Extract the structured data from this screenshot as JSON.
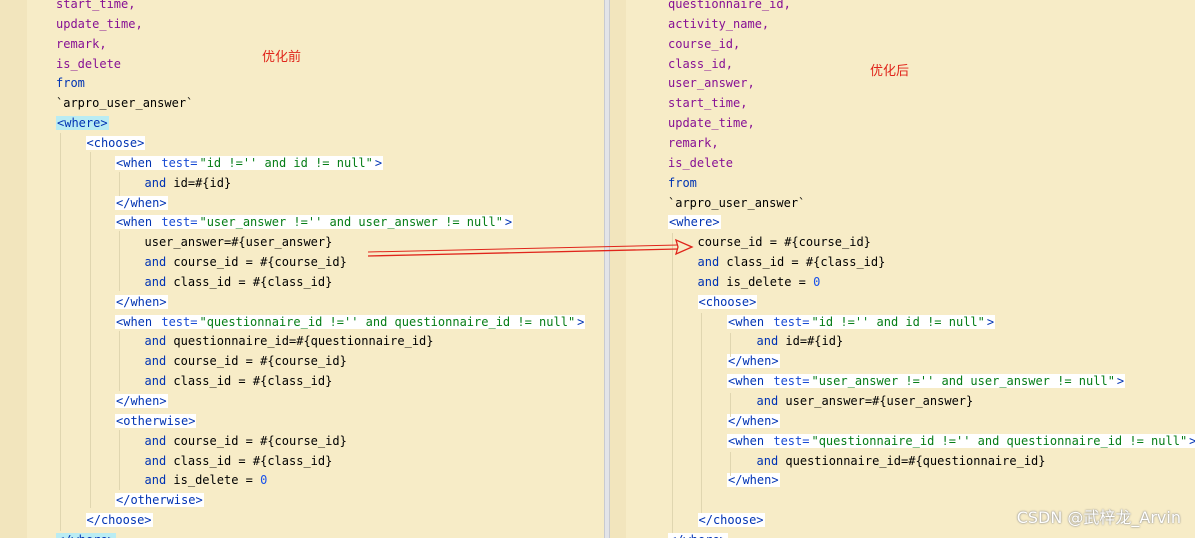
{
  "annotations": {
    "before": "优化前",
    "after": "优化后"
  },
  "watermark": "CSDN @武梓龙_Arvin",
  "left": {
    "lines": [
      {
        "indent": 0,
        "parts": [
          {
            "c": "col",
            "t": "start_time,"
          }
        ]
      },
      {
        "indent": 0,
        "parts": [
          {
            "c": "col",
            "t": "update_time,"
          }
        ]
      },
      {
        "indent": 0,
        "parts": [
          {
            "c": "col",
            "t": "remark,"
          }
        ]
      },
      {
        "indent": 0,
        "parts": [
          {
            "c": "col",
            "t": "is_delete"
          }
        ]
      },
      {
        "indent": 0,
        "parts": [
          {
            "c": "kw",
            "t": "from"
          }
        ]
      },
      {
        "indent": 0,
        "parts": [
          {
            "c": "txt",
            "t": "`arpro_user_answer`"
          }
        ]
      },
      {
        "indent": 0,
        "parts": [
          {
            "c": "tag hl",
            "t": "<where>"
          }
        ]
      },
      {
        "indent": 1,
        "parts": [
          {
            "c": "tag",
            "t": "<choose>"
          }
        ]
      },
      {
        "indent": 2,
        "parts": [
          {
            "c": "tag",
            "t": "<when "
          },
          {
            "c": "tag attr",
            "t": "test="
          },
          {
            "c": "tag str",
            "t": "\"id !='' and id != null\""
          },
          {
            "c": "tag",
            "t": ">"
          }
        ]
      },
      {
        "indent": 3,
        "parts": [
          {
            "c": "kw",
            "t": "and "
          },
          {
            "c": "txt",
            "t": "id=#{id}"
          }
        ]
      },
      {
        "indent": 2,
        "parts": [
          {
            "c": "tag",
            "t": "</when>"
          }
        ]
      },
      {
        "indent": 2,
        "parts": [
          {
            "c": "tag",
            "t": "<when "
          },
          {
            "c": "tag attr",
            "t": "test="
          },
          {
            "c": "tag str",
            "t": "\"user_answer !='' and user_answer != null\""
          },
          {
            "c": "tag",
            "t": ">"
          }
        ]
      },
      {
        "indent": 3,
        "parts": [
          {
            "c": "txt",
            "t": "user_answer=#{user_answer}"
          }
        ]
      },
      {
        "indent": 3,
        "parts": [
          {
            "c": "kw",
            "t": "and "
          },
          {
            "c": "txt",
            "t": "course_id = #{course_id}"
          }
        ]
      },
      {
        "indent": 3,
        "parts": [
          {
            "c": "kw",
            "t": "and "
          },
          {
            "c": "txt",
            "t": "class_id = #{class_id}"
          }
        ]
      },
      {
        "indent": 2,
        "parts": [
          {
            "c": "tag",
            "t": "</when>"
          }
        ]
      },
      {
        "indent": 2,
        "parts": [
          {
            "c": "tag",
            "t": "<when "
          },
          {
            "c": "tag attr",
            "t": "test="
          },
          {
            "c": "tag str",
            "t": "\"questionnaire_id !='' and questionnaire_id != null\""
          },
          {
            "c": "tag",
            "t": ">"
          }
        ]
      },
      {
        "indent": 3,
        "parts": [
          {
            "c": "kw",
            "t": "and "
          },
          {
            "c": "txt",
            "t": "questionnaire_id=#{questionnaire_id}"
          }
        ]
      },
      {
        "indent": 3,
        "parts": [
          {
            "c": "kw",
            "t": "and "
          },
          {
            "c": "txt",
            "t": "course_id = #{course_id}"
          }
        ]
      },
      {
        "indent": 3,
        "parts": [
          {
            "c": "kw",
            "t": "and "
          },
          {
            "c": "txt",
            "t": "class_id = #{class_id}"
          }
        ]
      },
      {
        "indent": 2,
        "parts": [
          {
            "c": "tag",
            "t": "</when>"
          }
        ]
      },
      {
        "indent": 2,
        "parts": [
          {
            "c": "tag",
            "t": "<otherwise>"
          }
        ]
      },
      {
        "indent": 3,
        "parts": [
          {
            "c": "kw",
            "t": "and "
          },
          {
            "c": "txt",
            "t": "course_id = #{course_id}"
          }
        ]
      },
      {
        "indent": 3,
        "parts": [
          {
            "c": "kw",
            "t": "and "
          },
          {
            "c": "txt",
            "t": "class_id = #{class_id}"
          }
        ]
      },
      {
        "indent": 3,
        "parts": [
          {
            "c": "kw",
            "t": "and "
          },
          {
            "c": "txt",
            "t": "is_delete = "
          },
          {
            "c": "num",
            "t": "0"
          }
        ]
      },
      {
        "indent": 2,
        "parts": [
          {
            "c": "tag",
            "t": "</otherwise>"
          }
        ]
      },
      {
        "indent": 1,
        "parts": [
          {
            "c": "tag",
            "t": "</choose>"
          }
        ]
      },
      {
        "indent": 0,
        "parts": [
          {
            "c": "tag hl",
            "t": "</where>"
          }
        ]
      }
    ]
  },
  "right": {
    "lines": [
      {
        "indent": 0,
        "parts": [
          {
            "c": "col",
            "t": "questionnaire_id,"
          }
        ]
      },
      {
        "indent": 0,
        "parts": [
          {
            "c": "col",
            "t": "activity_name,"
          }
        ]
      },
      {
        "indent": 0,
        "parts": [
          {
            "c": "col",
            "t": "course_id,"
          }
        ]
      },
      {
        "indent": 0,
        "parts": [
          {
            "c": "col",
            "t": "class_id,"
          }
        ]
      },
      {
        "indent": 0,
        "parts": [
          {
            "c": "col",
            "t": "user_answer,"
          }
        ]
      },
      {
        "indent": 0,
        "parts": [
          {
            "c": "col",
            "t": "start_time,"
          }
        ]
      },
      {
        "indent": 0,
        "parts": [
          {
            "c": "col",
            "t": "update_time,"
          }
        ]
      },
      {
        "indent": 0,
        "parts": [
          {
            "c": "col",
            "t": "remark,"
          }
        ]
      },
      {
        "indent": 0,
        "parts": [
          {
            "c": "col",
            "t": "is_delete"
          }
        ]
      },
      {
        "indent": 0,
        "parts": [
          {
            "c": "kw",
            "t": "from"
          }
        ]
      },
      {
        "indent": 0,
        "parts": [
          {
            "c": "txt",
            "t": "`arpro_user_answer`"
          }
        ]
      },
      {
        "indent": 0,
        "parts": [
          {
            "c": "tag",
            "t": "<where>"
          }
        ]
      },
      {
        "indent": 1,
        "parts": [
          {
            "c": "txt",
            "t": "course_id = #{course_id}"
          }
        ]
      },
      {
        "indent": 1,
        "parts": [
          {
            "c": "kw",
            "t": "and "
          },
          {
            "c": "txt",
            "t": "class_id = #{class_id}"
          }
        ]
      },
      {
        "indent": 1,
        "parts": [
          {
            "c": "kw",
            "t": "and "
          },
          {
            "c": "txt",
            "t": "is_delete = "
          },
          {
            "c": "num",
            "t": "0"
          }
        ]
      },
      {
        "indent": 1,
        "parts": [
          {
            "c": "tag",
            "t": "<choose>"
          }
        ]
      },
      {
        "indent": 2,
        "parts": [
          {
            "c": "tag",
            "t": "<when "
          },
          {
            "c": "tag attr",
            "t": "test="
          },
          {
            "c": "tag str",
            "t": "\"id !='' and id != null\""
          },
          {
            "c": "tag",
            "t": ">"
          }
        ]
      },
      {
        "indent": 3,
        "parts": [
          {
            "c": "kw",
            "t": "and "
          },
          {
            "c": "txt",
            "t": "id=#{id}"
          }
        ]
      },
      {
        "indent": 2,
        "parts": [
          {
            "c": "tag",
            "t": "</when>"
          }
        ]
      },
      {
        "indent": 2,
        "parts": [
          {
            "c": "tag",
            "t": "<when "
          },
          {
            "c": "tag attr",
            "t": "test="
          },
          {
            "c": "tag str",
            "t": "\"user_answer !='' and user_answer != null\""
          },
          {
            "c": "tag",
            "t": ">"
          }
        ]
      },
      {
        "indent": 3,
        "parts": [
          {
            "c": "kw",
            "t": "and "
          },
          {
            "c": "txt",
            "t": "user_answer=#{user_answer}"
          }
        ]
      },
      {
        "indent": 2,
        "parts": [
          {
            "c": "tag",
            "t": "</when>"
          }
        ]
      },
      {
        "indent": 2,
        "parts": [
          {
            "c": "tag",
            "t": "<when "
          },
          {
            "c": "tag attr",
            "t": "test="
          },
          {
            "c": "tag str",
            "t": "\"questionnaire_id !='' and questionnaire_id != null\""
          },
          {
            "c": "tag",
            "t": ">"
          }
        ]
      },
      {
        "indent": 3,
        "parts": [
          {
            "c": "kw",
            "t": "and "
          },
          {
            "c": "txt",
            "t": "questionnaire_id=#{questionnaire_id}"
          }
        ]
      },
      {
        "indent": 2,
        "parts": [
          {
            "c": "tag",
            "t": "</when>"
          }
        ]
      },
      {
        "indent": 0,
        "parts": [
          {
            "c": "txt",
            "t": ""
          }
        ]
      },
      {
        "indent": 1,
        "parts": [
          {
            "c": "tag",
            "t": "</choose>"
          }
        ]
      },
      {
        "indent": 0,
        "parts": [
          {
            "c": "tag",
            "t": "</where>"
          }
        ]
      }
    ]
  }
}
